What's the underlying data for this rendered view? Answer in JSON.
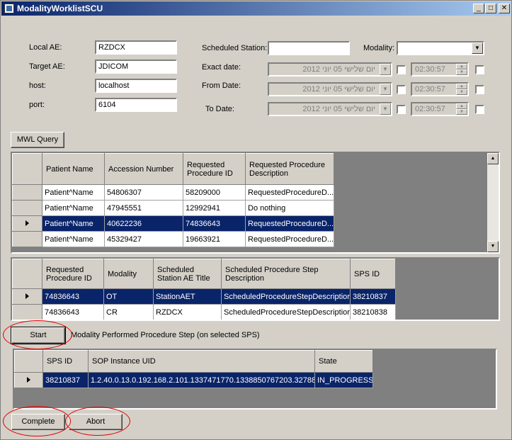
{
  "window": {
    "title": "ModalityWorklistSCU",
    "minimize": "_",
    "maximize": "□",
    "close": "✕"
  },
  "form": {
    "local_ae_label": "Local AE:",
    "local_ae_value": "RZDCX",
    "target_ae_label": "Target AE:",
    "target_ae_value": "JDICOM",
    "host_label": "host:",
    "host_value": "localhost",
    "port_label": "port:",
    "port_value": "6104",
    "scheduled_station_label": "Scheduled Station:",
    "scheduled_station_value": "",
    "modality_label": "Modality:",
    "modality_value": "",
    "exact_date_label": "Exact date:",
    "from_date_label": "From Date:",
    "to_date_label": "To Date:",
    "date_text": "יום שלישי    05 יוני     2012",
    "time_text": "02:30:57"
  },
  "mwl_query_button": "MWL Query",
  "worklist_table": {
    "headers": [
      "Patient Name",
      "Accession Number",
      "Requested Procedure ID",
      "Requested Procedure Description"
    ],
    "rows": [
      [
        "Patient^Name",
        "54806307",
        "58209000",
        "RequestedProcedureD..."
      ],
      [
        "Patient^Name",
        "47945551",
        "12992941",
        "Do nothing"
      ],
      [
        "Patient^Name",
        "40622236",
        "74836643",
        "RequestedProcedureD..."
      ],
      [
        "Patient^Name",
        "45329427",
        "19663921",
        "RequestedProcedureD..."
      ]
    ]
  },
  "sps_table": {
    "headers": [
      "Requested Procedure ID",
      "Modality",
      "Scheduled Station AE Title",
      "Scheduled Procedure Step Description",
      "SPS ID"
    ],
    "rows": [
      [
        "74836643",
        "OT",
        "StationAET",
        "ScheduledProcedureStepDescription",
        "38210837"
      ],
      [
        "74836643",
        "CR",
        "RZDCX",
        "ScheduledProcedureStepDescription",
        "38210838"
      ]
    ]
  },
  "start_button": "Start",
  "mpps_label": "Modality Performed Procedure Step (on selected SPS)",
  "mpps_table": {
    "headers": [
      "SPS ID",
      "SOP Instance UID",
      "State"
    ],
    "rows": [
      [
        "38210837",
        "1.2.40.0.13.0.192.168.2.101.1337471770.1338850767203.32788",
        "IN_PROGRESS"
      ]
    ]
  },
  "complete_button": "Complete",
  "abort_button": "Abort",
  "colors": {
    "selection": "#0a246a",
    "annotation": "#e00000",
    "face": "#d4d0c8"
  }
}
